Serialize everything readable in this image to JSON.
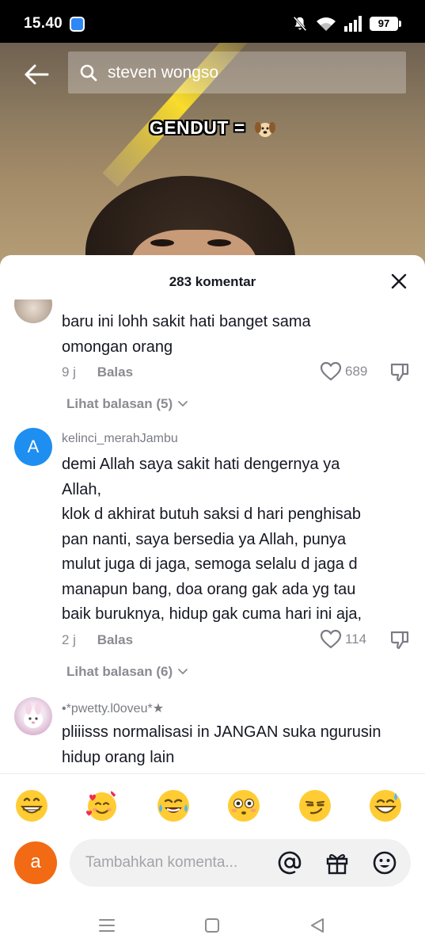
{
  "status": {
    "time": "15.40",
    "battery": "97"
  },
  "search": {
    "query": "steven wongso"
  },
  "video": {
    "caption": "GENDUT =",
    "caption_emoji": "dog-face"
  },
  "sheet": {
    "title": "283 komentar"
  },
  "comments": [
    {
      "username": "",
      "text": "baru ini lohh sakit hati banget sama\nomongan orang",
      "time": "9 j",
      "reply_label": "Balas",
      "likes": "689",
      "view_replies": "Lihat balasan (5)"
    },
    {
      "username": "kelinci_merahJambu",
      "avatar_letter": "A",
      "text": "demi Allah saya sakit hati dengernya ya\nAllah,\nklok d akhirat butuh saksi d hari penghisab\npan nanti, saya bersedia ya Allah, punya\nmulut juga di jaga, semoga selalu d jaga d\nmanapun bang, doa orang gak ada yg tau\nbaik buruknya, hidup gak cuma hari ini aja,",
      "time": "2 j",
      "reply_label": "Balas",
      "likes": "114",
      "view_replies": "Lihat balasan (6)"
    },
    {
      "username": "•*pwetty.l0oveu*★",
      "text": "pliiisss normalisasi in JANGAN suka ngurusin\nhidup orang lain"
    }
  ],
  "emoji_bar": [
    "grinning-face",
    "smiling-face-with-hearts",
    "tears-of-joy-face",
    "flushed-face",
    "smirking-face",
    "grinning-sweat-face"
  ],
  "input": {
    "my_avatar_letter": "a",
    "placeholder": "Tambahkan komenta..."
  },
  "colors": {
    "accent_blue": "#1e8ef0",
    "my_avatar": "#f26a14",
    "text": "#161823",
    "muted": "#8a8b91"
  }
}
